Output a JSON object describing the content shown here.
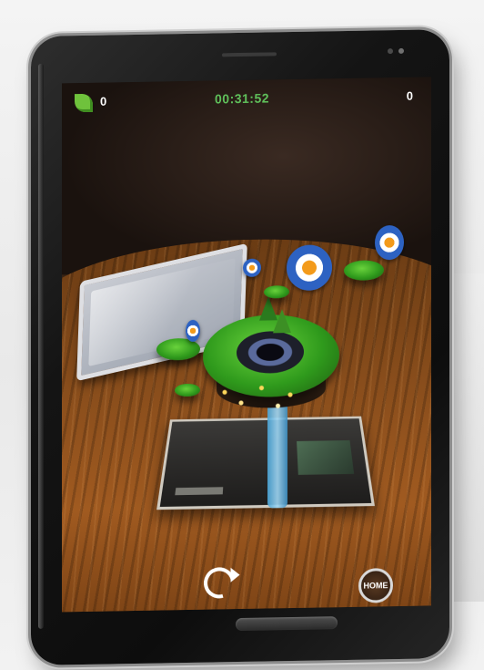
{
  "hud": {
    "leaf_count": "0",
    "timer": "00:31:52",
    "score": "0"
  },
  "controls": {
    "home_label": "HOME"
  },
  "icons": [
    "leaf-icon",
    "reset-icon",
    "home-icon"
  ],
  "colors": {
    "timer_green": "#5fbf5a",
    "leaf_green": "#6fc23c",
    "target_blue": "#2d62c2",
    "target_orange": "#f39a1a"
  }
}
